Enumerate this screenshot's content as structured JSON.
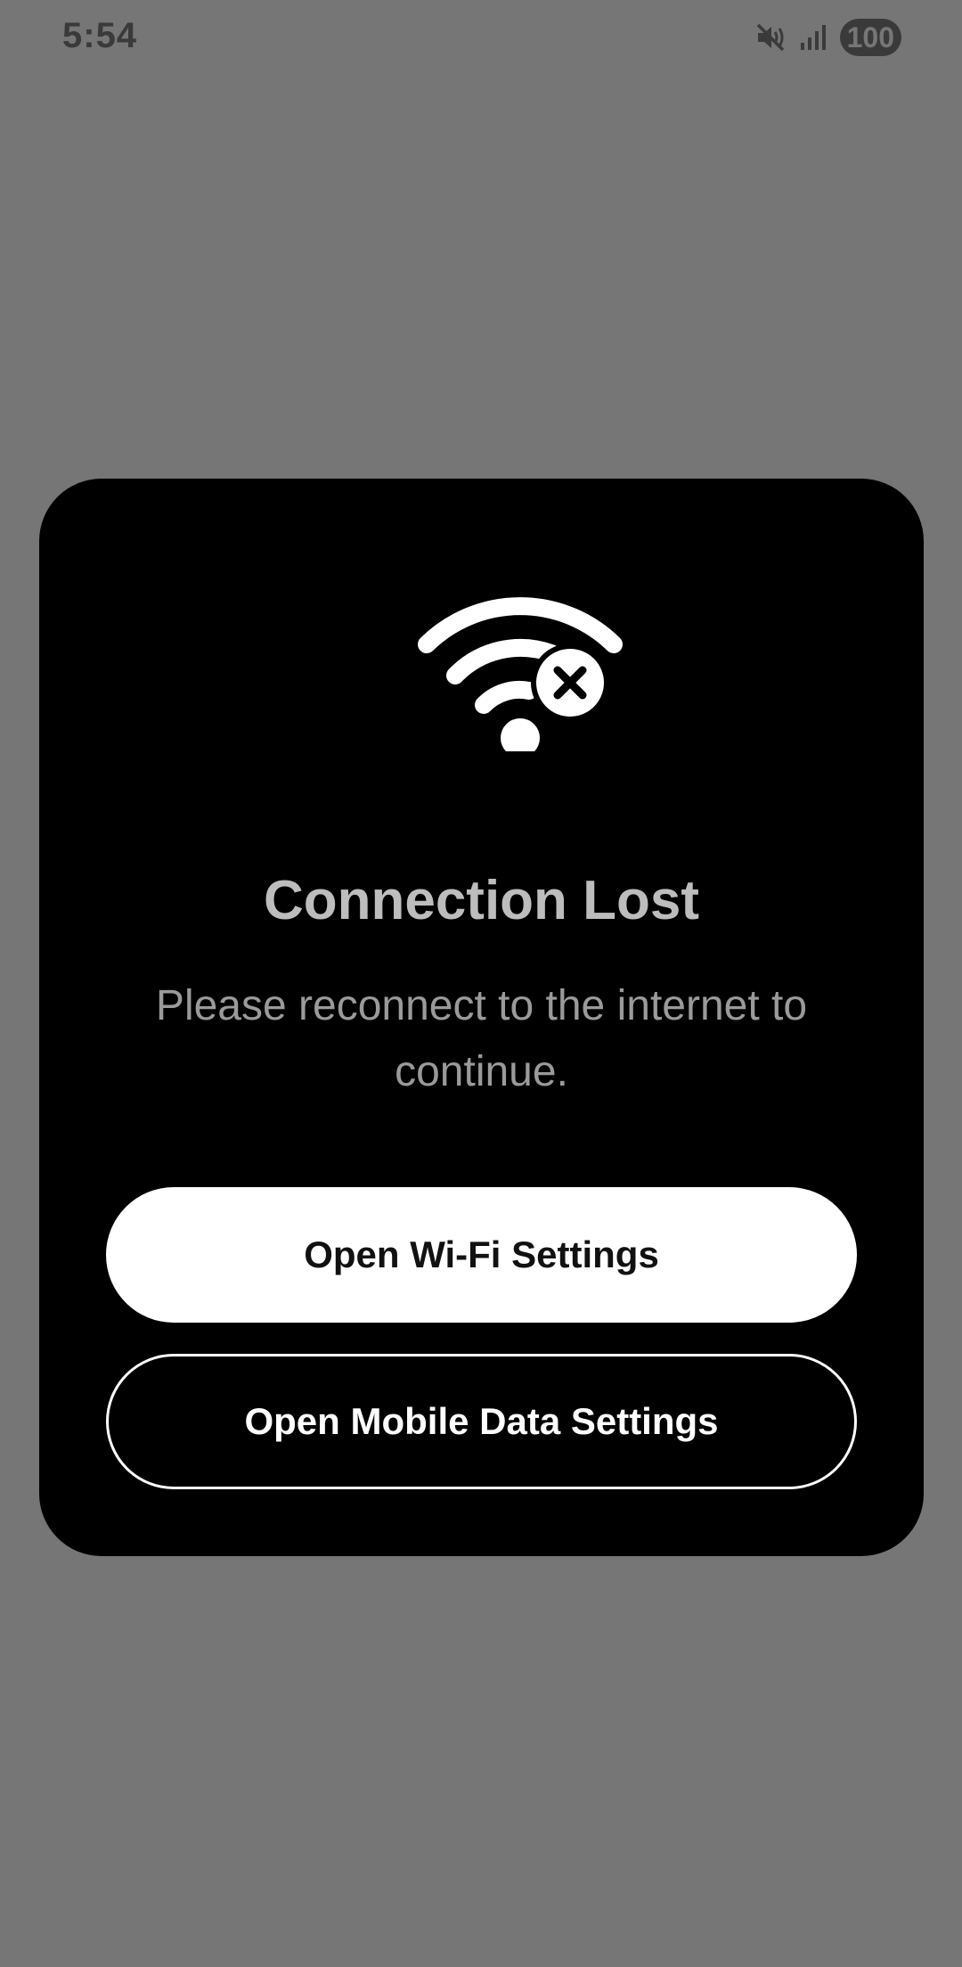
{
  "status_bar": {
    "time": "5:54",
    "battery_level": "100",
    "icons": [
      "mute-vibrate-icon",
      "signal-icon",
      "battery-icon"
    ]
  },
  "dialog": {
    "icon": "wifi-off-icon",
    "title": "Connection Lost",
    "message": "Please reconnect to the internet to continue.",
    "primary_button": "Open Wi-Fi Settings",
    "secondary_button": "Open Mobile Data Settings"
  },
  "colors": {
    "backdrop": "#767676",
    "dialog_background": "#000000",
    "primary_button_background": "#ffffff",
    "secondary_button_border": "#ffffff",
    "title_text": "#bdbdbd",
    "message_text": "#9a9a9a"
  }
}
